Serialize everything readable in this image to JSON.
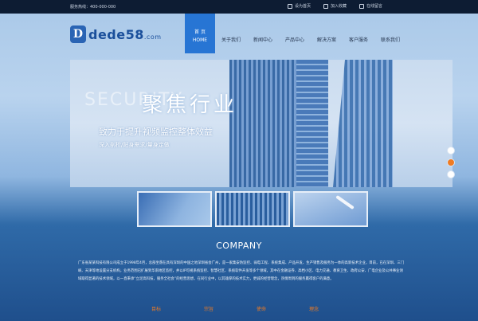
{
  "topbar": {
    "phone": "服务热线：400-000-000",
    "links": [
      {
        "icon": "home-icon",
        "label": "设为首页"
      },
      {
        "icon": "bookmark-icon",
        "label": "加入收藏"
      },
      {
        "icon": "message-icon",
        "label": "在线留言"
      }
    ]
  },
  "logo": {
    "mark": "D",
    "text": "dede58",
    "suffix": ".com"
  },
  "nav": {
    "active_label": "首 页",
    "active_en": "HOME",
    "items": [
      "关于我们",
      "新闻中心",
      "产品中心",
      "解决方案",
      "客户服务",
      "联系我们"
    ]
  },
  "banner": {
    "watermark": "SECURITY",
    "title": "聚焦行业",
    "subtitle": "致力于提升视频监控整体效益",
    "subtitle2": "深入剖析/贴身需求/量身定做"
  },
  "company": {
    "title": "COMPANY",
    "text": "广东省某某科技有限公司成立于1998年4月，总部坐落在具有深圳的中国之地深圳省会广州，是一家集安防监控、弱电工程、系统集成、产品开发、生产销售及服务为一体的高新技术企业，目前，已在深圳、三门峡、天津等地设置分支机构，业务范围已扩展到华南地区监控，并以IP可视系统监控、智慧社区、系统软件开发等多个领域，其中在金融证券、高档小区、电力交通、教育卫生、政府公安、广电企业及公共事业领域取得显著的技术领域，以一直秉承“立足高科技，服务全社会”的经营思想，在同行业中，以其雄厚的技术实力，更诚的经营理念，热情周到的服务赢得客户的满意。"
  },
  "bottom_links": [
    "目标",
    "宗旨",
    "使命",
    "理念"
  ],
  "colors": {
    "accent": "#2775d4",
    "orange": "#f07b22",
    "topbar": "#0d1c33"
  }
}
